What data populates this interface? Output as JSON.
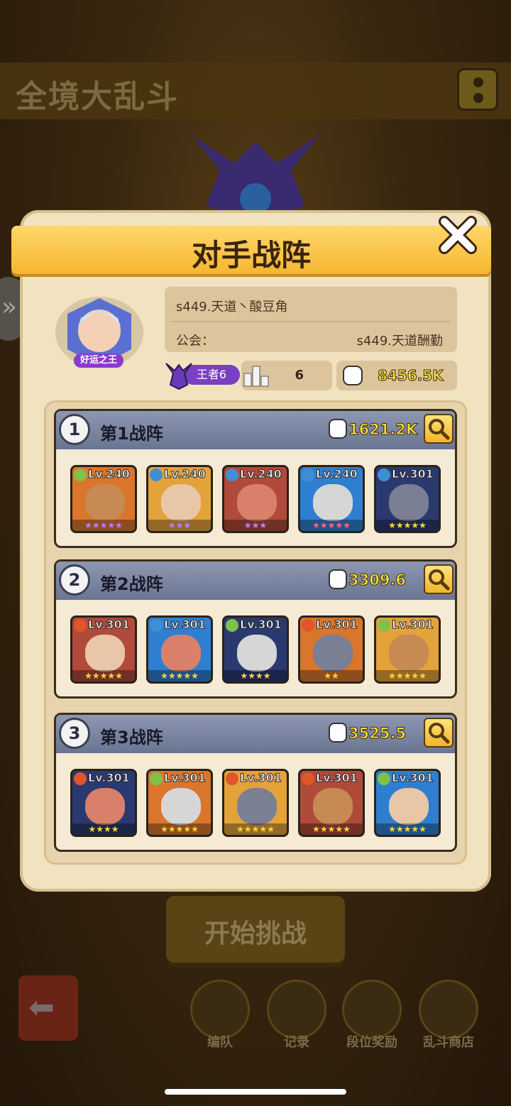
{
  "page_title": "全境大乱斗",
  "dialog": {
    "title": "对手战阵",
    "player": {
      "name": "s449.天道丶酸豆角",
      "guild_label": "公会：",
      "guild_name": "s449.天道酬勤",
      "avatar_badge": "好运之王",
      "rank": "王者6",
      "position_number": "6",
      "total_power": "8456.5K"
    },
    "teams": [
      {
        "number": "1",
        "title": "第1战阵",
        "power": "1621.2K",
        "heroes": [
          {
            "level": "Lv.240",
            "element": "leaf",
            "stars": 5,
            "star_color": "purple"
          },
          {
            "level": "Lv.240",
            "element": "water",
            "stars": 3,
            "star_color": "purple"
          },
          {
            "level": "Lv.240",
            "element": "water",
            "stars": 3,
            "star_color": "purple"
          },
          {
            "level": "Lv.240",
            "element": "water",
            "stars": 5,
            "star_color": "red"
          },
          {
            "level": "Lv.301",
            "element": "water",
            "stars": 5,
            "star_color": "gold"
          }
        ]
      },
      {
        "number": "2",
        "title": "第2战阵",
        "power": "3309.6",
        "heroes": [
          {
            "level": "Lv.301",
            "element": "fire",
            "stars": 5,
            "star_color": "gold"
          },
          {
            "level": "Lv.301",
            "element": "water",
            "stars": 5,
            "star_color": "gold"
          },
          {
            "level": "Lv.301",
            "element": "leaf",
            "stars": 4,
            "star_color": "gold"
          },
          {
            "level": "Lv.301",
            "element": "fire",
            "stars": 2,
            "star_color": "gold"
          },
          {
            "level": "Lv.301",
            "element": "leaf",
            "stars": 5,
            "star_color": "gold"
          }
        ]
      },
      {
        "number": "3",
        "title": "第3战阵",
        "power": "3525.5",
        "heroes": [
          {
            "level": "Lv.301",
            "element": "fire",
            "stars": 4,
            "star_color": "gold"
          },
          {
            "level": "Lv.301",
            "element": "leaf",
            "stars": 5,
            "star_color": "gold"
          },
          {
            "level": "Lv.301",
            "element": "fire",
            "stars": 5,
            "star_color": "gold"
          },
          {
            "level": "Lv.301",
            "element": "fire",
            "stars": 5,
            "star_color": "gold"
          },
          {
            "level": "Lv.301",
            "element": "leaf",
            "stars": 5,
            "star_color": "gold"
          }
        ]
      }
    ]
  },
  "start_button_label": "开始挑战",
  "bottom_nav": [
    {
      "label": "编队",
      "icon": "formation-icon"
    },
    {
      "label": "记录",
      "icon": "record-icon"
    },
    {
      "label": "段位奖励",
      "icon": "rank-reward-icon"
    },
    {
      "label": "乱斗商店",
      "icon": "shop-icon"
    }
  ],
  "colors": {
    "header_gold": "#f5b631",
    "power_yellow": "#f7e33a",
    "team_header_blue": "#6a7591",
    "rank_purple": "#7a3fc4"
  }
}
